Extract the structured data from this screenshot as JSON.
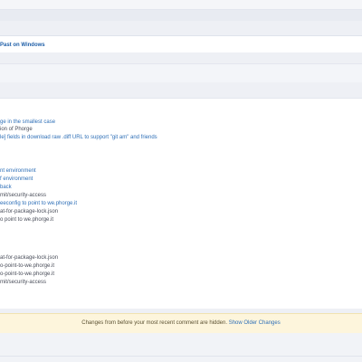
{
  "header": {
    "title": "Past on Windows"
  },
  "content": {
    "lines": [
      {
        "text": "ge in the smallest case",
        "kind": "link"
      },
      {
        "text": "ion of Phorge",
        "kind": "text"
      },
      {
        "text": "le] fields in download raw .diff URL to support \"git am\" and friends",
        "kind": "link"
      },
      {
        "text": "nt environment",
        "kind": "link"
      },
      {
        "text": "f environment",
        "kind": "link"
      },
      {
        "text": "back",
        "kind": "link"
      },
      {
        "text": "mit/security-access",
        "kind": "text"
      },
      {
        "text": "eeconfig to point to we.phorge.it",
        "kind": "link"
      },
      {
        "text": "at-for-package-lock.json",
        "kind": "text"
      },
      {
        "text": "o point to we.phorge.it",
        "kind": "text"
      },
      {
        "text": "at-for-package-lock.json",
        "kind": "text"
      },
      {
        "text": "o-point-to-we.phorge.it",
        "kind": "text"
      },
      {
        "text": "o-point-to-we.phorge.it",
        "kind": "text"
      },
      {
        "text": "mit/security-access",
        "kind": "text"
      }
    ]
  },
  "notice": {
    "message": "Changes from before your most recent comment are hidden.",
    "link_label": "Show Older Changes"
  }
}
